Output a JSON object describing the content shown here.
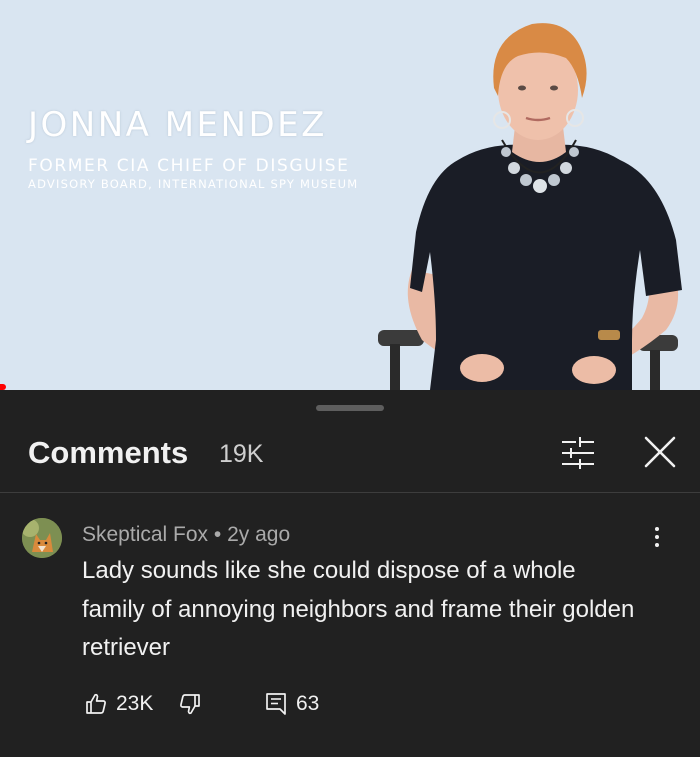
{
  "video": {
    "lower_third": {
      "name": "JONNA MENDEZ",
      "title": "FORMER CIA CHIEF OF DISGUISE",
      "affiliation": "ADVISORY BOARD, INTERNATIONAL SPY MUSEUM"
    },
    "background_color": "#d9e5f1",
    "progress_color": "#ff0000"
  },
  "comments_panel": {
    "title": "Comments",
    "count": "19K",
    "filter_icon": "sort-filter-icon",
    "close_icon": "close-icon",
    "background_color": "#212121",
    "comments": [
      {
        "author": "Skeptical Fox",
        "separator": "•",
        "time": "2y ago",
        "text": "Lady sounds like she could dispose of a whole family of annoying neighbors and frame their golden retriever",
        "likes": "23K",
        "replies": "63",
        "avatar_icon": "fox-avatar",
        "menu_icon": "more-vertical-icon"
      }
    ]
  }
}
